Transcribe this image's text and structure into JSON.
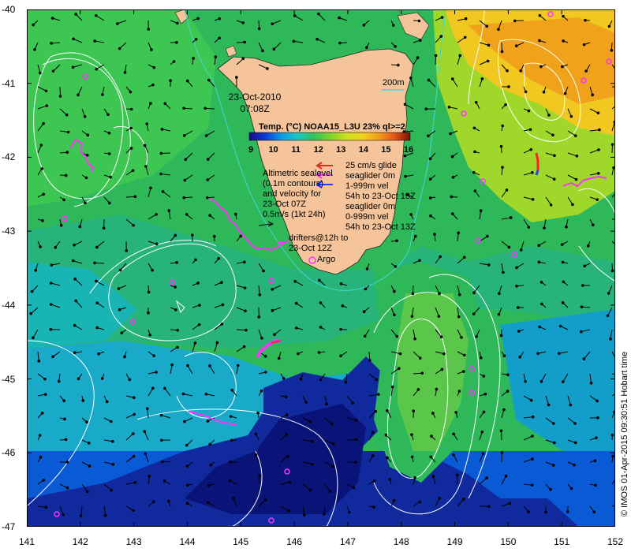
{
  "title": {
    "date": "23-Oct-2010",
    "time": "07:08Z"
  },
  "colorbar": {
    "title": "Temp. (°C) NOAA15_L3U 23% ql>=2",
    "ticks": [
      "9",
      "10",
      "11",
      "12",
      "13",
      "14",
      "15",
      "16"
    ],
    "colors": [
      "#1a0a8c",
      "#0a3bd6",
      "#0a9ae6",
      "#19c7c7",
      "#2fc35a",
      "#7bd12d",
      "#c9e01c",
      "#f0d21a",
      "#f0a21a",
      "#e8571a",
      "#b8220f",
      "#7a1008"
    ]
  },
  "depth_label": "200m",
  "legend": {
    "altimetry_lines": [
      "Altimetric sealevel",
      "(0.1m contours)",
      "and velocity for",
      "23-Oct 07Z",
      "0.5m/s (1kt 24h)"
    ],
    "glider_lines": [
      "25 cm/s glide",
      "seaglider 0m",
      "1-999m vel",
      "54h to 23-Oct 13Z",
      "seaglider 0m",
      "0-999m vel",
      "54h to 23-Oct 13Z"
    ],
    "drifter_lines": [
      "drifters@12h to",
      "23-Oct 12Z"
    ],
    "argo_label": "Argo"
  },
  "axes": {
    "x_ticks": [
      "141",
      "142",
      "143",
      "144",
      "145",
      "146",
      "147",
      "148",
      "149",
      "150",
      "151",
      "152"
    ],
    "y_ticks": [
      "-40",
      "-41",
      "-42",
      "-43",
      "-44",
      "-45",
      "-46",
      "-47"
    ],
    "xlim": [
      141,
      152
    ],
    "ylim": [
      -47,
      -40
    ]
  },
  "credit": "© IMOS 01-Apr-2015 09:30:51 Hobart time",
  "colors": {
    "land": "#f5c49a",
    "contour": "#ffffff",
    "depth_contour": "#3fd8d8",
    "drifter": "#ff33ff",
    "glider": "#ff2020",
    "glider_blue": "#2040ff"
  }
}
